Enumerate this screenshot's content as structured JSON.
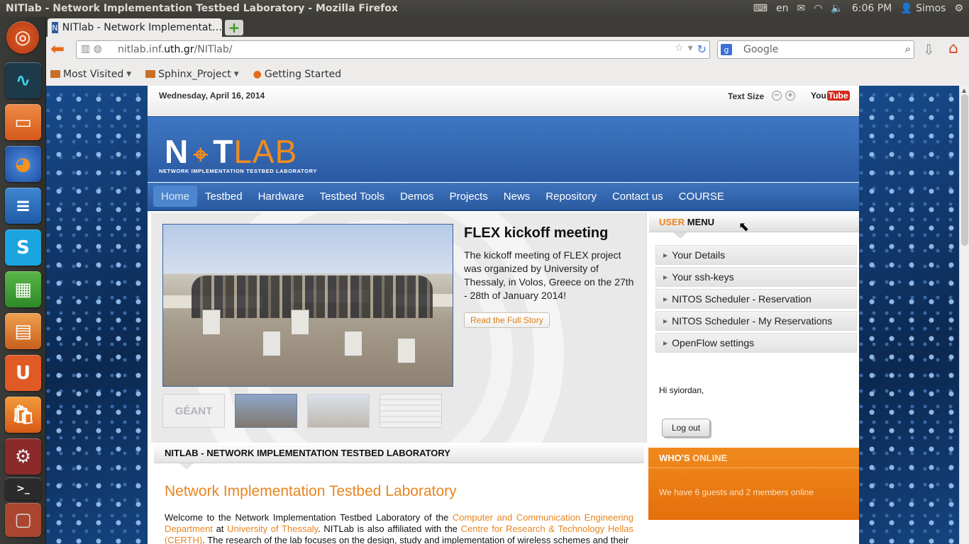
{
  "os": {
    "window_title": "NITlab - Network Implementation Testbed Laboratory - Mozilla Firefox",
    "indicators": {
      "lang": "en",
      "time": "6:06 PM",
      "user": "Simos"
    },
    "launcher": [
      "ubuntu-dash-icon",
      "system-monitor-icon",
      "files-icon",
      "firefox-icon",
      "writer-icon",
      "skype-icon",
      "calc-icon",
      "impress-icon",
      "ubuntu-one-icon",
      "software-center-icon",
      "system-settings-icon",
      "terminal-icon",
      "workspaces-icon"
    ]
  },
  "browser": {
    "tab_title": "NITlab - Network Implementat…",
    "url_prefix": "nitlab.inf.",
    "url_domain": "uth.gr",
    "url_suffix": "/NITlab/",
    "search_placeholder": "Google",
    "bookmarks": [
      "Most Visited",
      "Sphinx_Project",
      "Getting Started"
    ]
  },
  "site": {
    "date": "Wednesday, April 16, 2014",
    "text_size_label": "Text Size",
    "zoom_out": "−",
    "zoom_in": "+",
    "youtube_you": "You",
    "youtube_tube": "Tube",
    "logo": {
      "n": "N",
      "t": "T",
      "lab": "LAB",
      "subtitle": "NETWORK IMPLEMENTATION TESTBED LABORATORY"
    },
    "menu": [
      "Home",
      "Testbed",
      "Hardware",
      "Testbed Tools",
      "Demos",
      "Projects",
      "News",
      "Repository",
      "Contact us",
      "COURSE"
    ],
    "slide": {
      "title": "FLEX kickoff meeting",
      "text": "The kickoff meeting of FLEX project was organized by University of Thessaly, in Volos, Greece on the 27th - 28th of January 2014!",
      "read_more": "Read the Full Story",
      "thumb1_label": "GÉANT"
    },
    "section_title": "NITLAB - NETWORK IMPLEMENTATION TESTBED LABORATORY",
    "article": {
      "heading": "Network Implementation Testbed Laboratory",
      "p1": "Welcome to the Network Implementation Testbed Laboratory of the ",
      "link1": "Computer and Communication Engineering Department",
      "p2": " at ",
      "link2": "University of Thessaly",
      "p3": ". NITLab is also affiliated with the ",
      "link3": "Centre for Research & Technology Hellas (CERTH)",
      "p4": ". The research of the lab focuses on the design, study and implementation of wireless schemes and their"
    },
    "user_menu": {
      "title_highlight": "USER",
      "title_rest": " MENU",
      "items": [
        "Your Details",
        "Your ssh-keys",
        "NITOS Scheduler - Reservation",
        "NITOS Scheduler - My Reservations",
        "OpenFlow settings"
      ]
    },
    "greeting": "Hi syiordan,",
    "logout": "Log out",
    "whos_online": {
      "title_highlight": "WHO'S",
      "title_rest": " ONLINE",
      "text": "We have 6 guests and 2 members online"
    }
  },
  "colors": {
    "accent_orange": "#e8851f",
    "header_blue": "#2a5aa2",
    "ubuntu_panel": "#3c3b37"
  }
}
